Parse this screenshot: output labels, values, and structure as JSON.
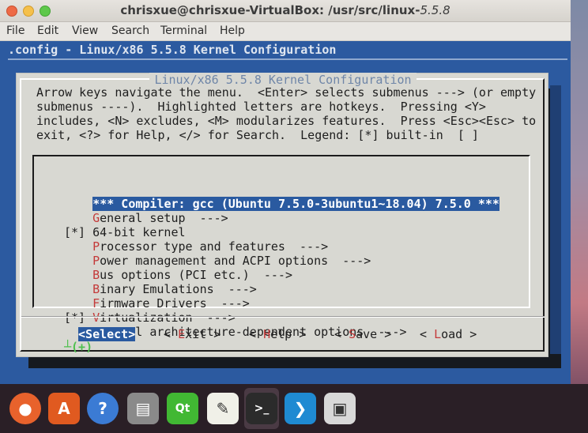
{
  "window": {
    "title_prefix": "chrisxue@chrisxue-VirtualBox: /usr/src/linux-",
    "title_version": "5.5.8"
  },
  "menubar": [
    "File",
    "Edit",
    "View",
    "Search",
    "Terminal",
    "Help"
  ],
  "terminal": {
    "header": ".config - Linux/x86 5.5.8 Kernel Configuration",
    "dialog_title": "Linux/x86 5.5.8 Kernel Configuration",
    "help_lines": [
      "Arrow keys navigate the menu.  <Enter> selects submenus ---> (or empty",
      "submenus ----).  Highlighted letters are hotkeys.  Pressing <Y>",
      "includes, <N> excludes, <M> modularizes features.  Press <Esc><Esc> to",
      "exit, <?> for Help, </> for Search.  Legend: [*] built-in  [ ]"
    ],
    "menu_items": [
      {
        "prefix": "    ",
        "hotkey": "",
        "rest": "*** Compiler: gcc (Ubuntu 7.5.0-3ubuntu1~18.04) 7.5.0 ***",
        "selected": true
      },
      {
        "prefix": "    ",
        "hotkey": "G",
        "rest": "eneral setup  --->",
        "selected": false
      },
      {
        "prefix": "[*] ",
        "hotkey": "",
        "rest": "64-bit kernel",
        "selected": false
      },
      {
        "prefix": "    ",
        "hotkey": "P",
        "rest": "rocessor type and features  --->",
        "selected": false
      },
      {
        "prefix": "    ",
        "hotkey": "P",
        "rest": "ower management and ACPI options  --->",
        "selected": false
      },
      {
        "prefix": "    ",
        "hotkey": "B",
        "rest": "us options (PCI etc.)  --->",
        "selected": false
      },
      {
        "prefix": "    ",
        "hotkey": "B",
        "rest": "inary Emulations  --->",
        "selected": false
      },
      {
        "prefix": "    ",
        "hotkey": "F",
        "rest": "irmware Drivers  --->",
        "selected": false
      },
      {
        "prefix": "[*] ",
        "hotkey": "V",
        "rest": "irtualization  --->",
        "selected": false
      },
      {
        "prefix": "    ",
        "hotkey": "G",
        "rest": "eneral architecture-dependent options  --->",
        "selected": false
      }
    ],
    "more_indicator": "(+)",
    "buttons": [
      {
        "pre": "<",
        "hotkey": "S",
        "post": "elect>",
        "active": true
      },
      {
        "pre": "< ",
        "hotkey": "E",
        "post": "xit >",
        "active": false
      },
      {
        "pre": "< ",
        "hotkey": "H",
        "post": "elp >",
        "active": false
      },
      {
        "pre": "< ",
        "hotkey": "S",
        "post": "ave >",
        "active": false
      },
      {
        "pre": "< ",
        "hotkey": "L",
        "post": "oad >",
        "active": false
      }
    ]
  },
  "dock": [
    {
      "name": "firefox-icon",
      "color": "#e8622c",
      "glyph": "●"
    },
    {
      "name": "software-center-icon",
      "color": "#e05a20",
      "glyph": "A"
    },
    {
      "name": "help-icon",
      "color": "#3b7bd4",
      "glyph": "?"
    },
    {
      "name": "files-icon",
      "color": "#8a8a8a",
      "glyph": "▤"
    },
    {
      "name": "qt-creator-icon",
      "color": "#41b833",
      "glyph": "Qt"
    },
    {
      "name": "text-editor-icon",
      "color": "#f0f0e8",
      "glyph": "✎"
    },
    {
      "name": "terminal-icon",
      "color": "#2b2b2b",
      "glyph": ">_"
    },
    {
      "name": "vscode-icon",
      "color": "#1f8ad2",
      "glyph": "❯"
    },
    {
      "name": "usb-drive-icon",
      "color": "#d8d8d8",
      "glyph": "▣"
    }
  ]
}
